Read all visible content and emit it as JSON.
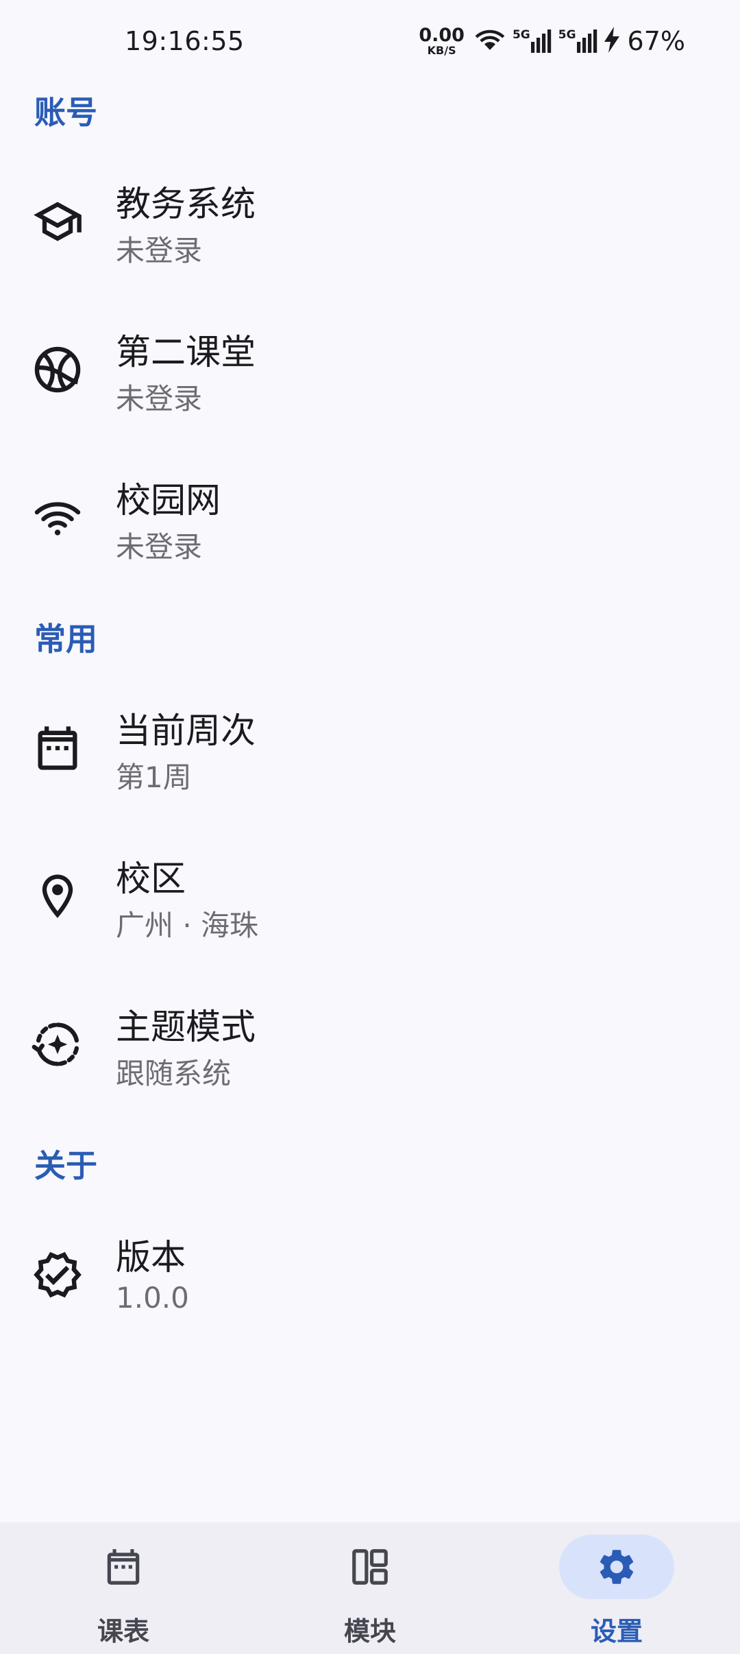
{
  "status_bar": {
    "time": "19:16:55",
    "net_speed_value": "0.00",
    "net_speed_unit": "KB/S",
    "signal1_label": "5G",
    "signal2_label": "5G",
    "battery_percent": "67%",
    "icons": [
      "wifi-icon",
      "signal-5g-icon",
      "signal-5g-icon",
      "charging-bolt-icon"
    ]
  },
  "sections": {
    "account": {
      "header": "账号",
      "items": [
        {
          "title": "教务系统",
          "subtitle": "未登录",
          "icon": "graduation-cap-icon"
        },
        {
          "title": "第二课堂",
          "subtitle": "未登录",
          "icon": "basketball-icon"
        },
        {
          "title": "校园网",
          "subtitle": "未登录",
          "icon": "wifi-icon"
        }
      ]
    },
    "common": {
      "header": "常用",
      "items": [
        {
          "title": "当前周次",
          "subtitle": "第1周",
          "icon": "calendar-icon"
        },
        {
          "title": "校区",
          "subtitle": "广州 · 海珠",
          "icon": "location-pin-icon"
        },
        {
          "title": "主题模式",
          "subtitle": "跟随系统",
          "icon": "theme-auto-icon"
        }
      ]
    },
    "about": {
      "header": "关于",
      "items": [
        {
          "title": "版本",
          "subtitle": "1.0.0",
          "icon": "verified-badge-icon"
        }
      ]
    }
  },
  "bottom_nav": {
    "items": [
      {
        "label": "课表",
        "icon": "calendar-icon",
        "active": false
      },
      {
        "label": "模块",
        "icon": "modules-icon",
        "active": false
      },
      {
        "label": "设置",
        "icon": "gear-icon",
        "active": true
      }
    ]
  },
  "colors": {
    "background": "#f8f8fd",
    "accent": "#2a5cb5",
    "nav_background": "#eeeef4",
    "active_pill": "#d9e2fb",
    "subtitle": "#6c6c72"
  }
}
